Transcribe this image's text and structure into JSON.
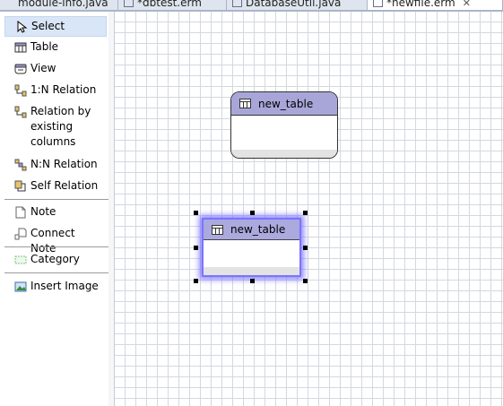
{
  "tabs": [
    {
      "label": "module-info.java",
      "active": false
    },
    {
      "label": "*dbtest.erm",
      "active": false
    },
    {
      "label": "DatabaseUtil.java",
      "active": false
    },
    {
      "label": "*newfile.erm",
      "active": true,
      "close": "✕"
    }
  ],
  "palette": {
    "select": "Select",
    "table": "Table",
    "view": "View",
    "relation_1n": "1:N Relation",
    "relation_existing": "Relation by existing columns",
    "relation_nn": "N:N Relation",
    "self_relation": "Self Relation",
    "note": "Note",
    "connect_note": "Connect Note",
    "category": "Category",
    "insert_image": "Insert Image",
    "selected_item": "Select"
  },
  "diagram": {
    "tables": [
      {
        "name": "new_table",
        "selected": false
      },
      {
        "name": "new_table",
        "selected": true
      }
    ]
  },
  "colors": {
    "table_header": "#a8a6d8",
    "selection": "#7b74ff",
    "grid": "#d3d8e0",
    "palette_selected": "#d9e6f7"
  },
  "icons": {
    "tab": "table-icon",
    "select": "arrow-cursor-icon",
    "table": "table-icon",
    "view": "view-icon",
    "relation": "relation-icon",
    "note": "note-icon",
    "category": "category-icon",
    "image": "image-icon"
  }
}
